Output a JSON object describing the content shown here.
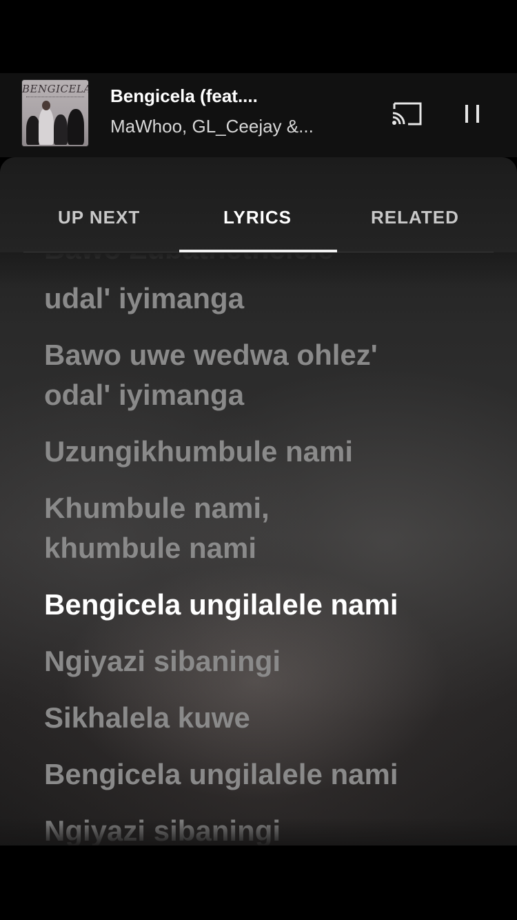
{
  "player": {
    "title": "Bengicela (feat....",
    "artist": "MaWhoo, GL_Ceejay &...",
    "album_art_text": "BENGICELA"
  },
  "icons": {
    "cast": "cast-icon",
    "pause": "pause-icon"
  },
  "tabs": [
    {
      "label": "UP NEXT",
      "active": false
    },
    {
      "label": "LYRICS",
      "active": true
    },
    {
      "label": "RELATED",
      "active": false
    }
  ],
  "lyrics": {
    "partial_top": "Bawo Zubathethelele",
    "lines": [
      "udal' iyimanga",
      "Bawo uwe wedwa ohlez'",
      "odal' iyimanga",
      "Uzungikhumbule nami",
      "Khumbule nami,",
      "khumbule nami",
      "Bengicela ungilalele nami",
      "Ngiyazi sibaningi",
      "Sikhalela kuwe",
      "Bengicela ungilalele nami",
      "Ngiyazi sibaningi"
    ],
    "current_line": "Bengicela ungilalele nami"
  },
  "colors": {
    "background": "#000000",
    "mini_player": "#111111",
    "active_text": "#ffffff",
    "inactive_lyric": "#8a8a8a",
    "tab_inactive": "#c9c9c9"
  }
}
